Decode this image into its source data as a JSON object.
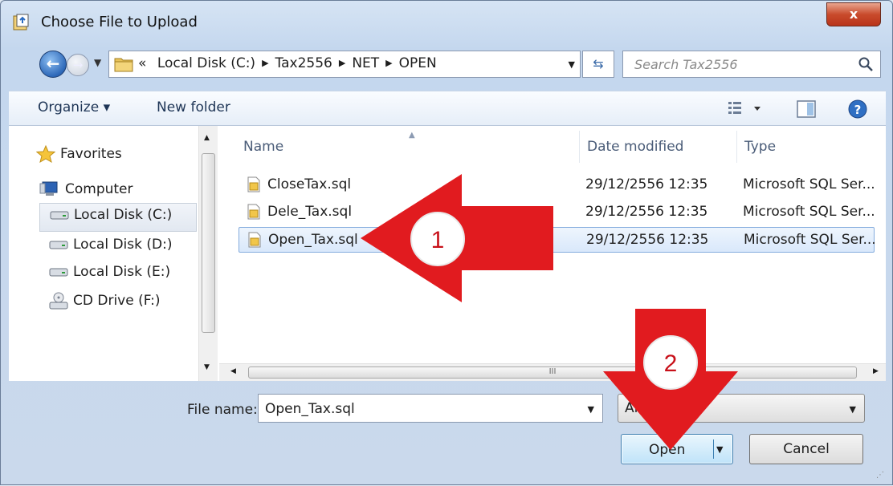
{
  "window": {
    "title": "Choose File to Upload",
    "close_label": "x"
  },
  "nav": {
    "back_label": "←",
    "forward_label": "→",
    "breadcrumb": [
      "«",
      "Local Disk (C:)",
      "Tax2556",
      "NET",
      "OPEN"
    ],
    "search_placeholder": "Search Tax2556"
  },
  "toolbar": {
    "organize_label": "Organize ▾",
    "new_folder_label": "New folder"
  },
  "sidebar": {
    "items": [
      {
        "label": "Favorites",
        "icon": "star-icon"
      },
      {
        "label": "Computer",
        "icon": "computer-icon"
      },
      {
        "label": "Local Disk (C:)",
        "icon": "drive-icon"
      },
      {
        "label": "Local Disk (D:)",
        "icon": "drive-icon"
      },
      {
        "label": "Local Disk (E:)",
        "icon": "drive-icon"
      },
      {
        "label": "CD Drive (F:)",
        "icon": "cd-drive-icon"
      }
    ],
    "selected_index": 2
  },
  "files": {
    "columns": [
      "Name",
      "Date modified",
      "Type"
    ],
    "rows": [
      {
        "name": "CloseTax.sql",
        "date": "29/12/2556 12:35",
        "type": "Microsoft SQL Ser..."
      },
      {
        "name": "Dele_Tax.sql",
        "date": "29/12/2556 12:35",
        "type": "Microsoft SQL Ser..."
      },
      {
        "name": "Open_Tax.sql",
        "date": "29/12/2556 12:35",
        "type": "Microsoft SQL Ser..."
      }
    ],
    "selected_index": 2,
    "hscroll_grip": "III"
  },
  "bottom": {
    "file_name_label": "File name:",
    "file_name_value": "Open_Tax.sql",
    "file_type_value": "All ...)",
    "open_label": "Open",
    "cancel_label": "Cancel"
  },
  "annotations": [
    {
      "number": "1",
      "points_to": "Open_Tax.sql"
    },
    {
      "number": "2",
      "points_to": "Open"
    }
  ],
  "colors": {
    "arrow": "#e11b1f",
    "selection": "#d9e8fb",
    "accent": "#3c7fb1"
  }
}
